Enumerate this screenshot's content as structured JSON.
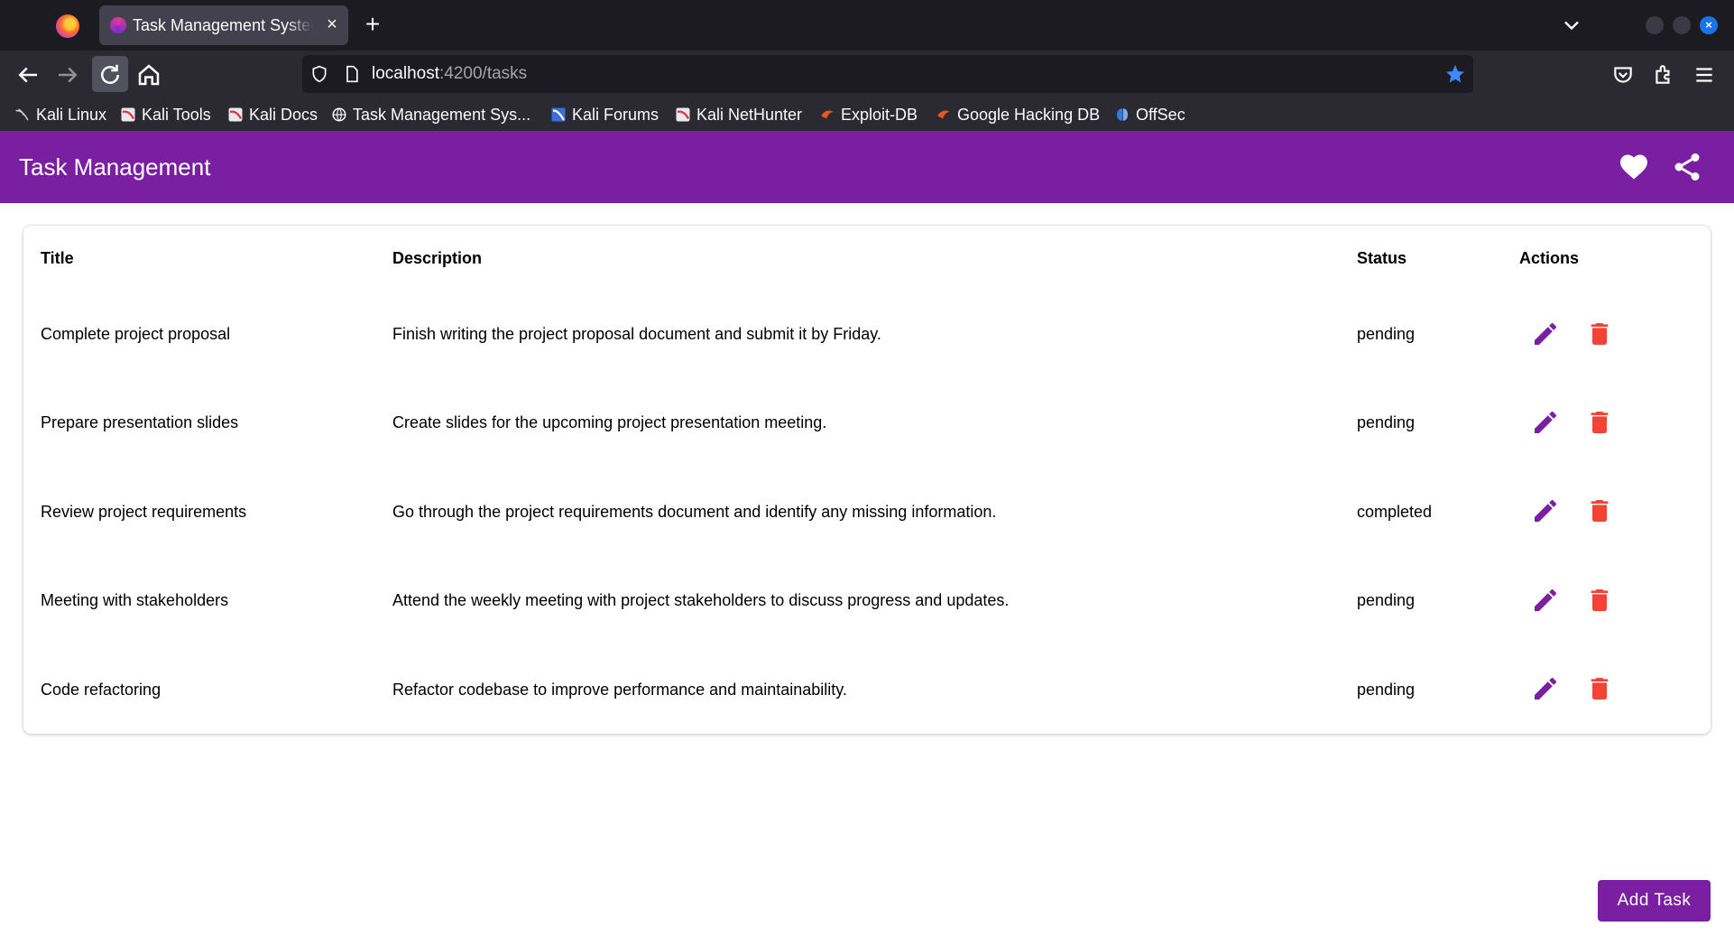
{
  "browser": {
    "tab_title": "Task Management System",
    "tab_close": "×",
    "new_tab": "+",
    "url_host": "localhost",
    "url_path": ":4200/tasks",
    "bookmarks": [
      {
        "label": "Kali Linux",
        "icon": "kali-dragon-icon"
      },
      {
        "label": "Kali Tools",
        "icon": "kali-icon"
      },
      {
        "label": "Kali Docs",
        "icon": "kali-icon"
      },
      {
        "label": "Task Management Sys...",
        "icon": "globe-icon"
      },
      {
        "label": "Kali Forums",
        "icon": "kali-forums-icon"
      },
      {
        "label": "Kali NetHunter",
        "icon": "kali-icon"
      },
      {
        "label": "Exploit-DB",
        "icon": "exploit-db-icon"
      },
      {
        "label": "Google Hacking DB",
        "icon": "exploit-db-icon"
      },
      {
        "label": "OffSec",
        "icon": "offsec-icon"
      }
    ]
  },
  "app": {
    "title": "Task Management",
    "accent": "#7b1fa2",
    "delete_color": "#f44336",
    "toolbar_icons": [
      "heart-icon",
      "share-icon"
    ]
  },
  "table": {
    "columns": {
      "title": "Title",
      "description": "Description",
      "status": "Status",
      "actions": "Actions"
    },
    "rows": [
      {
        "title": "Complete project proposal",
        "description": "Finish writing the project proposal document and submit it by Friday.",
        "status": "pending"
      },
      {
        "title": "Prepare presentation slides",
        "description": "Create slides for the upcoming project presentation meeting.",
        "status": "pending"
      },
      {
        "title": "Review project requirements",
        "description": "Go through the project requirements document and identify any missing information.",
        "status": "completed"
      },
      {
        "title": "Meeting with stakeholders",
        "description": "Attend the weekly meeting with project stakeholders to discuss progress and updates.",
        "status": "pending"
      },
      {
        "title": "Code refactoring",
        "description": "Refactor codebase to improve performance and maintainability.",
        "status": "pending"
      }
    ]
  },
  "add_button_label": "Add Task"
}
